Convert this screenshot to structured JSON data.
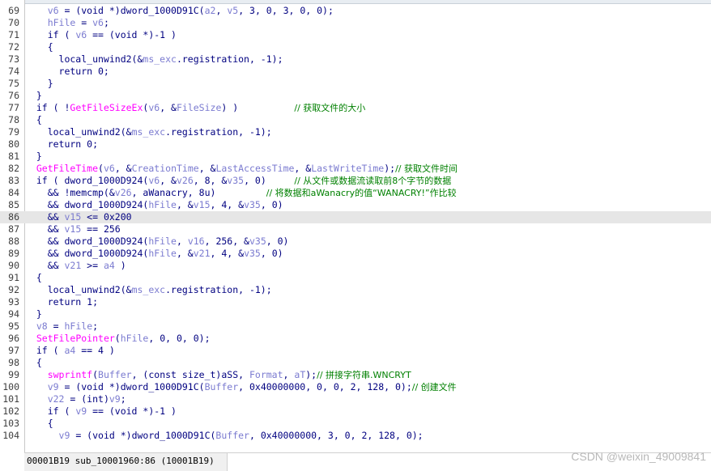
{
  "lines": [
    {
      "n": "69",
      "tokens": [
        [
          "    ",
          ""
        ],
        [
          "v6",
          "var"
        ],
        [
          " = (void *)",
          ""
        ],
        [
          "dword_1000D91C",
          "tk"
        ],
        [
          "(",
          ""
        ],
        [
          "a2",
          "var"
        ],
        [
          ", ",
          ""
        ],
        [
          "v5",
          "var"
        ],
        [
          ", 3, 0, 3, 0, 0);",
          ""
        ]
      ]
    },
    {
      "n": "70",
      "tokens": [
        [
          "    ",
          ""
        ],
        [
          "hFile",
          "var"
        ],
        [
          " = ",
          ""
        ],
        [
          "v6",
          "var"
        ],
        [
          ";",
          ""
        ]
      ]
    },
    {
      "n": "71",
      "tokens": [
        [
          "    if ( ",
          ""
        ],
        [
          "v6",
          "var"
        ],
        [
          " == (void *)-1 )",
          ""
        ]
      ]
    },
    {
      "n": "72",
      "tokens": [
        [
          "    {",
          ""
        ]
      ]
    },
    {
      "n": "73",
      "tokens": [
        [
          "      local_unwind2(&",
          ""
        ],
        [
          "ms_exc",
          "var"
        ],
        [
          ".registration, -1);",
          ""
        ]
      ]
    },
    {
      "n": "74",
      "tokens": [
        [
          "      return 0;",
          ""
        ]
      ]
    },
    {
      "n": "75",
      "tokens": [
        [
          "    }",
          ""
        ]
      ]
    },
    {
      "n": "76",
      "tokens": [
        [
          "  }",
          ""
        ]
      ]
    },
    {
      "n": "77",
      "tokens": [
        [
          "  if ( !",
          ""
        ],
        [
          "GetFileSizeEx",
          "fn"
        ],
        [
          "(",
          ""
        ],
        [
          "v6",
          "var"
        ],
        [
          ", &",
          ""
        ],
        [
          "FileSize",
          "var"
        ],
        [
          ") )          ",
          ""
        ],
        [
          "// 获取文件的大小",
          "cm"
        ]
      ]
    },
    {
      "n": "78",
      "tokens": [
        [
          "  {",
          ""
        ]
      ]
    },
    {
      "n": "79",
      "tokens": [
        [
          "    local_unwind2(&",
          ""
        ],
        [
          "ms_exc",
          "var"
        ],
        [
          ".registration, -1);",
          ""
        ]
      ]
    },
    {
      "n": "80",
      "tokens": [
        [
          "    return 0;",
          ""
        ]
      ]
    },
    {
      "n": "81",
      "tokens": [
        [
          "  }",
          ""
        ]
      ]
    },
    {
      "n": "82",
      "tokens": [
        [
          "  ",
          ""
        ],
        [
          "GetFileTime",
          "fn"
        ],
        [
          "(",
          ""
        ],
        [
          "v6",
          "var"
        ],
        [
          ", &",
          ""
        ],
        [
          "CreationTime",
          "var"
        ],
        [
          ", &",
          ""
        ],
        [
          "LastAccessTime",
          "var"
        ],
        [
          ", &",
          ""
        ],
        [
          "LastWriteTime",
          "var"
        ],
        [
          ");",
          ""
        ],
        [
          "// 获取文件时间",
          "cm"
        ]
      ]
    },
    {
      "n": "83",
      "tokens": [
        [
          "  if ( dword_1000D924(",
          ""
        ],
        [
          "v6",
          "var"
        ],
        [
          ", &",
          ""
        ],
        [
          "v26",
          "var"
        ],
        [
          ", 8, &",
          ""
        ],
        [
          "v35",
          "var"
        ],
        [
          ", 0)     ",
          ""
        ],
        [
          "// 从文件或数据流读取前8个字节的数据",
          "cm"
        ]
      ]
    },
    {
      "n": "84",
      "tokens": [
        [
          "    && !memcmp(&",
          ""
        ],
        [
          "v26",
          "var"
        ],
        [
          ", aWanacry, 8u)         ",
          ""
        ],
        [
          "// 将数据和aWanacry的值“WANACRY!”作比较",
          "cm"
        ]
      ]
    },
    {
      "n": "85",
      "tokens": [
        [
          "    && dword_1000D924(",
          ""
        ],
        [
          "hFile",
          "var"
        ],
        [
          ", &",
          ""
        ],
        [
          "v15",
          "var"
        ],
        [
          ", 4, &",
          ""
        ],
        [
          "v35",
          "var"
        ],
        [
          ", 0)",
          ""
        ]
      ]
    },
    {
      "n": "86",
      "tokens": [
        [
          "    && ",
          ""
        ],
        [
          "v15",
          "var"
        ],
        [
          " <= 0x200",
          ""
        ]
      ],
      "highlight": true
    },
    {
      "n": "87",
      "tokens": [
        [
          "    && ",
          ""
        ],
        [
          "v15",
          "var"
        ],
        [
          " == 256",
          ""
        ]
      ]
    },
    {
      "n": "88",
      "tokens": [
        [
          "    && dword_1000D924(",
          ""
        ],
        [
          "hFile",
          "var"
        ],
        [
          ", ",
          ""
        ],
        [
          "v16",
          "var"
        ],
        [
          ", 256, &",
          ""
        ],
        [
          "v35",
          "var"
        ],
        [
          ", 0)",
          ""
        ]
      ]
    },
    {
      "n": "89",
      "tokens": [
        [
          "    && dword_1000D924(",
          ""
        ],
        [
          "hFile",
          "var"
        ],
        [
          ", &",
          ""
        ],
        [
          "v21",
          "var"
        ],
        [
          ", 4, &",
          ""
        ],
        [
          "v35",
          "var"
        ],
        [
          ", 0)",
          ""
        ]
      ]
    },
    {
      "n": "90",
      "tokens": [
        [
          "    && ",
          ""
        ],
        [
          "v21",
          "var"
        ],
        [
          " >= ",
          ""
        ],
        [
          "a4",
          "var"
        ],
        [
          " )",
          ""
        ]
      ]
    },
    {
      "n": "91",
      "tokens": [
        [
          "  {",
          ""
        ]
      ]
    },
    {
      "n": "92",
      "tokens": [
        [
          "    local_unwind2(&",
          ""
        ],
        [
          "ms_exc",
          "var"
        ],
        [
          ".registration, -1);",
          ""
        ]
      ]
    },
    {
      "n": "93",
      "tokens": [
        [
          "    return 1;",
          ""
        ]
      ]
    },
    {
      "n": "94",
      "tokens": [
        [
          "  }",
          ""
        ]
      ]
    },
    {
      "n": "95",
      "tokens": [
        [
          "  ",
          ""
        ],
        [
          "v8",
          "var"
        ],
        [
          " = ",
          ""
        ],
        [
          "hFile",
          "var"
        ],
        [
          ";",
          ""
        ]
      ]
    },
    {
      "n": "96",
      "tokens": [
        [
          "  ",
          ""
        ],
        [
          "SetFilePointer",
          "fn"
        ],
        [
          "(",
          ""
        ],
        [
          "hFile",
          "var"
        ],
        [
          ", 0, 0, 0);",
          ""
        ]
      ]
    },
    {
      "n": "97",
      "tokens": [
        [
          "  if ( ",
          ""
        ],
        [
          "a4",
          "var"
        ],
        [
          " == 4 )",
          ""
        ]
      ]
    },
    {
      "n": "98",
      "tokens": [
        [
          "  {",
          ""
        ]
      ]
    },
    {
      "n": "99",
      "tokens": [
        [
          "    ",
          ""
        ],
        [
          "swprintf",
          "fn"
        ],
        [
          "(",
          ""
        ],
        [
          "Buffer",
          "var"
        ],
        [
          ", (const size_t)aSS, ",
          ""
        ],
        [
          "Format",
          "var"
        ],
        [
          ", ",
          ""
        ],
        [
          "aT",
          "var"
        ],
        [
          ");",
          ""
        ],
        [
          "// 拼接字符串.WNCRYT",
          "cm"
        ]
      ]
    },
    {
      "n": "100",
      "tokens": [
        [
          "    ",
          ""
        ],
        [
          "v9",
          "var"
        ],
        [
          " = (void *)dword_1000D91C(",
          ""
        ],
        [
          "Buffer",
          "var"
        ],
        [
          ", 0x40000000, 0, 0, 2, 128, 0);",
          ""
        ],
        [
          "// 创建文件",
          "cm"
        ]
      ]
    },
    {
      "n": "101",
      "tokens": [
        [
          "    ",
          ""
        ],
        [
          "v22",
          "var"
        ],
        [
          " = (int)",
          ""
        ],
        [
          "v9",
          "var"
        ],
        [
          ";",
          ""
        ]
      ]
    },
    {
      "n": "102",
      "tokens": [
        [
          "    if ( ",
          ""
        ],
        [
          "v9",
          "var"
        ],
        [
          " == (void *)-1 )",
          ""
        ]
      ]
    },
    {
      "n": "103",
      "tokens": [
        [
          "    {",
          ""
        ]
      ]
    },
    {
      "n": "104",
      "tokens": [
        [
          "      ",
          ""
        ],
        [
          "v9",
          "var"
        ],
        [
          " = (void *)dword_1000D91C(",
          ""
        ],
        [
          "Buffer",
          "var"
        ],
        [
          ", 0x40000000, 3, 0, 2, 128, 0);",
          ""
        ]
      ]
    }
  ],
  "status": {
    "text": "00001B19 sub_10001960:86 (10001B19)"
  },
  "watermark": "CSDN @weixin_49009841",
  "colors": {
    "plain": "#000080",
    "function": "#ff00ff",
    "variable": "#7b7bd0",
    "comment": "#008000",
    "highlight_line": "#e6e6e6"
  }
}
